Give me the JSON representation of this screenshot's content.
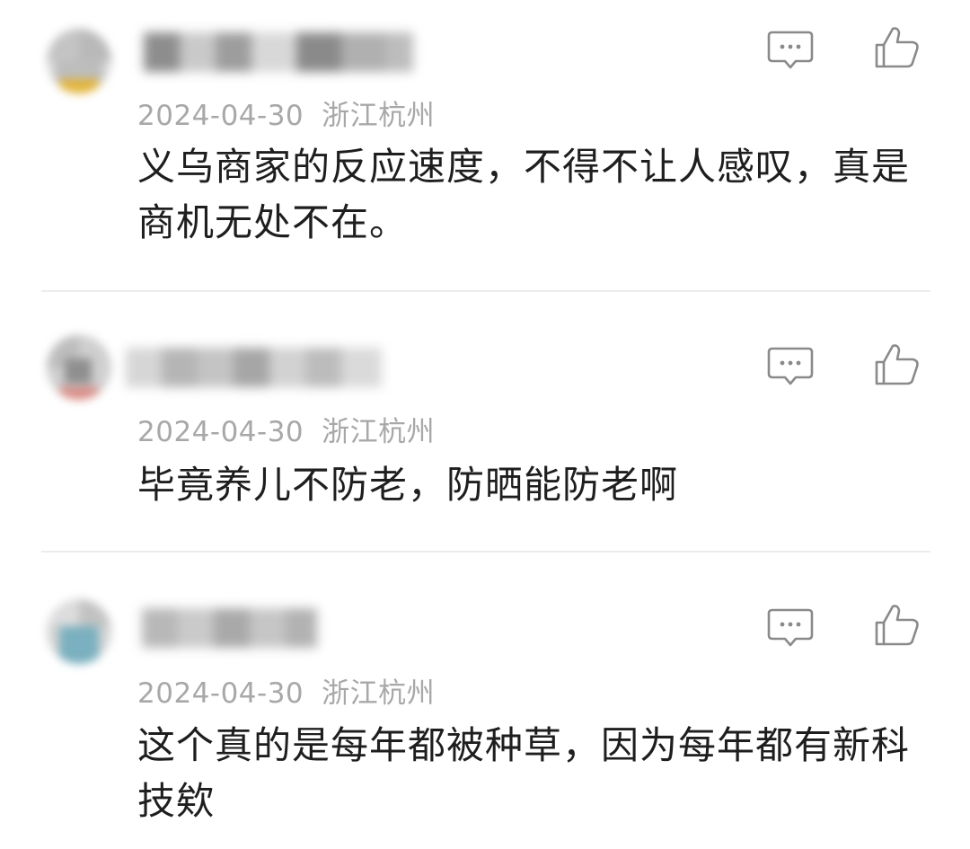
{
  "comments": [
    {
      "date": "2024-04-30",
      "location": "浙江杭州",
      "text": "义乌商家的反应速度，不得不让人感叹，真是商机无处不在。",
      "avatar_accent": "#e2b43a"
    },
    {
      "date": "2024-04-30",
      "location": "浙江杭州",
      "text": "毕竟养儿不防老，防晒能防老啊",
      "avatar_accent": "#d98a84"
    },
    {
      "date": "2024-04-30",
      "location": "浙江杭州",
      "text": "这个真的是每年都被种草，因为每年都有新科技欸",
      "avatar_accent": "#7ab0bf"
    }
  ],
  "icons": {
    "reply": "comment-bubble-icon",
    "like": "thumbs-up-icon"
  },
  "colors": {
    "text": "#1e1e1e",
    "meta": "#a8a8a8",
    "icon": "#8a8a8a",
    "divider": "#ececec"
  }
}
